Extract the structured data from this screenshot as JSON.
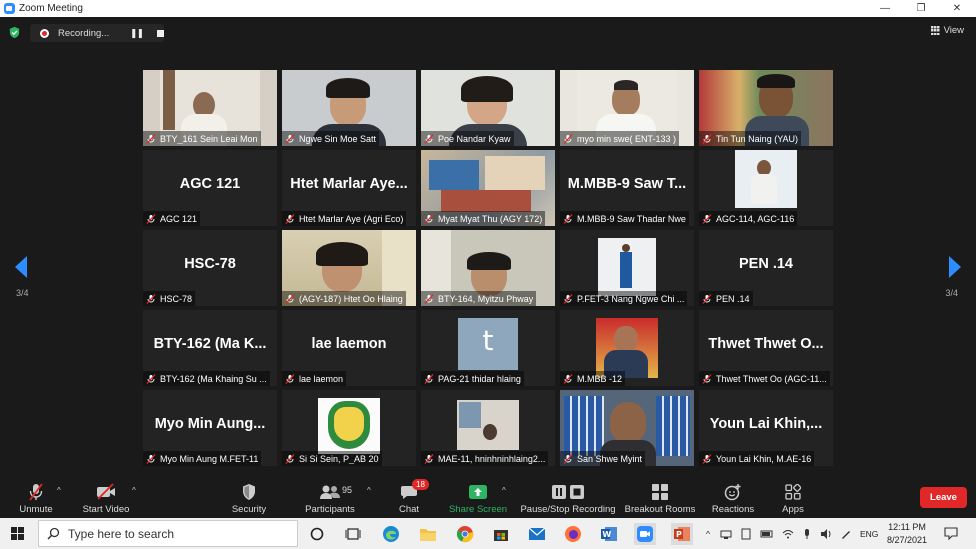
{
  "window": {
    "title": "Zoom Meeting"
  },
  "recording": {
    "status": "Recording..."
  },
  "view_label": "View",
  "pagination": {
    "left": "3/4",
    "right": "3/4"
  },
  "tiles": [
    {
      "label": "BTY_161 Sein Leai Mon",
      "big": "",
      "bg": "#d6cfc6"
    },
    {
      "label": "Ngwe Sin Moe Satt",
      "big": "",
      "bg": "#cfd0d2"
    },
    {
      "label": "Poe Nandar Kyaw",
      "big": "",
      "bg": "#e3e4e1"
    },
    {
      "label": "myo min swe( ENT-133 )",
      "big": "",
      "bg": "#e9e6df"
    },
    {
      "label": "Tin Tun Naing (YAU)",
      "big": "",
      "bg": "#8a7e6e"
    },
    {
      "label": "AGC 121",
      "big": "AGC 121",
      "bg": ""
    },
    {
      "label": "Htet Marlar Aye (Agri Eco)",
      "big": "Htet Marlar Aye...",
      "bg": ""
    },
    {
      "label": "Myat Myat Thu (AGY 172)",
      "big": "",
      "bg": "#b6a58c"
    },
    {
      "label": "M.MBB-9 Saw Thadar Nwe",
      "big": "M.MBB-9 Saw T...",
      "bg": ""
    },
    {
      "label": "AGC-114, AGC-116",
      "big": "",
      "bg": ""
    },
    {
      "label": "HSC-78",
      "big": "HSC-78",
      "bg": ""
    },
    {
      "label": "(AGY-187) Htet Oo Hlaing",
      "big": "",
      "bg": "#d5c8a9"
    },
    {
      "label": "BTY-164, Myitzu Phway",
      "big": "",
      "bg": "#cfcdbf"
    },
    {
      "label": "P.FET-3 Nang Ngwe Chi ...",
      "big": "",
      "bg": ""
    },
    {
      "label": "PEN .14",
      "big": "PEN .14",
      "bg": ""
    },
    {
      "label": "BTY-162 (Ma Khaing Su ...",
      "big": "BTY-162 (Ma K...",
      "bg": ""
    },
    {
      "label": "lae laemon",
      "big": "lae laemon",
      "bg": ""
    },
    {
      "label": "PAG-21 thidar hlaing",
      "big": "t",
      "bg": ""
    },
    {
      "label": "M.MBB -12",
      "big": "",
      "bg": ""
    },
    {
      "label": "Thwet Thwet Oo (AGC-11...",
      "big": "Thwet Thwet O...",
      "bg": ""
    },
    {
      "label": "Myo Min Aung M.FET-11",
      "big": "Myo Min Aung...",
      "bg": ""
    },
    {
      "label": "Si Si Sein, P_AB 20",
      "big": "",
      "bg": ""
    },
    {
      "label": "MAE-11, hninhninhlaing2...",
      "big": "",
      "bg": ""
    },
    {
      "label": "San Shwe Myint",
      "big": "",
      "bg": "#6d7d8e"
    },
    {
      "label": "Youn Lai Khin, M.AE-16",
      "big": "Youn Lai Khin,...",
      "bg": ""
    }
  ],
  "toolbar": {
    "unmute": "Unmute",
    "start_video": "Start Video",
    "security": "Security",
    "participants": "Participants",
    "participants_count": "95",
    "chat": "Chat",
    "chat_badge": "18",
    "share_screen": "Share Screen",
    "pause_stop": "Pause/Stop Recording",
    "breakout": "Breakout Rooms",
    "reactions": "Reactions",
    "apps": "Apps",
    "leave": "Leave"
  },
  "taskbar": {
    "search_placeholder": "Type here to search",
    "language": "ENG",
    "time": "12:11 PM",
    "date": "8/27/2021"
  },
  "colors": {
    "accent": "#2d8cff",
    "leave": "#e02828",
    "share": "#2fb463",
    "tile_bg": "#232323"
  }
}
